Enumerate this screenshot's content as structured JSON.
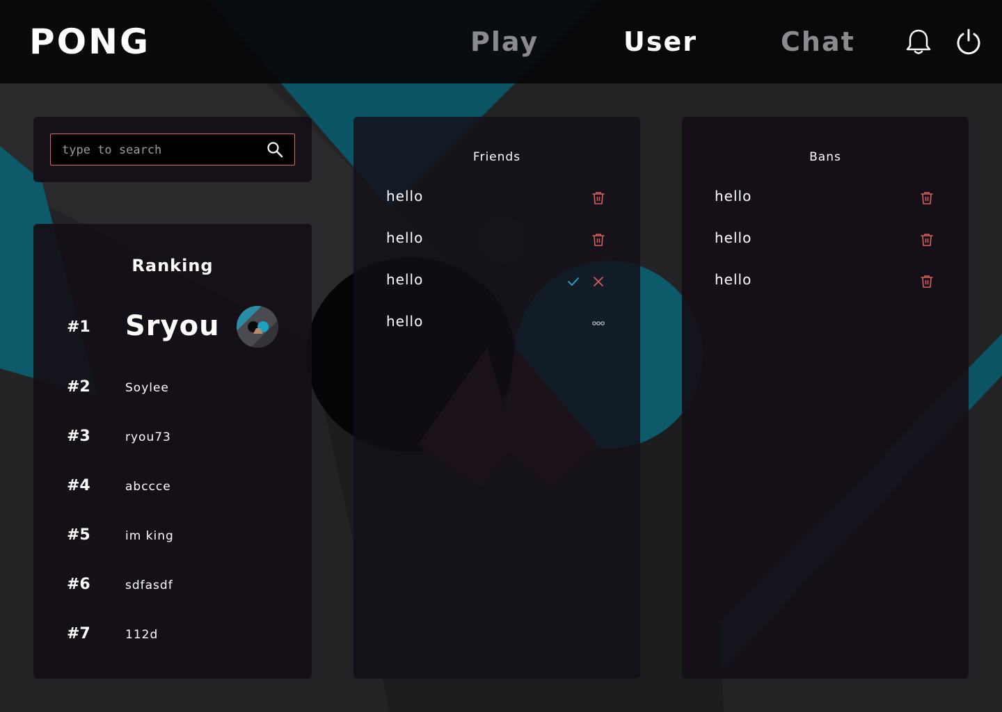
{
  "header": {
    "logo": "PONG",
    "nav": {
      "play": "Play",
      "user": "User",
      "chat": "Chat"
    },
    "active_tab": "User",
    "icons": {
      "notifications": "bell-icon",
      "logout": "power-icon"
    }
  },
  "search": {
    "placeholder": "type to search",
    "value": "",
    "icon": "search-icon"
  },
  "ranking": {
    "title": "Ranking",
    "entries": [
      {
        "rank": "#1",
        "name": "Sryou"
      },
      {
        "rank": "#2",
        "name": "Soylee"
      },
      {
        "rank": "#3",
        "name": "ryou73"
      },
      {
        "rank": "#4",
        "name": "abccce"
      },
      {
        "rank": "#5",
        "name": "im king"
      },
      {
        "rank": "#6",
        "name": "sdfasdf"
      },
      {
        "rank": "#7",
        "name": "112d"
      }
    ]
  },
  "friends": {
    "title": "Friends",
    "items": [
      {
        "name": "hello",
        "action": "trash-icon"
      },
      {
        "name": "hello",
        "action": "trash-icon"
      },
      {
        "name": "hello",
        "action": "accept-reject"
      },
      {
        "name": "hello",
        "action": "more-icon"
      }
    ]
  },
  "bans": {
    "title": "Bans",
    "items": [
      {
        "name": "hello",
        "action": "trash-icon"
      },
      {
        "name": "hello",
        "action": "trash-icon"
      },
      {
        "name": "hello",
        "action": "trash-icon"
      }
    ]
  },
  "colors": {
    "accent_teal": "#0c6677",
    "background": "#232325",
    "panel": "#140f17",
    "header": "#08080a",
    "danger": "#d9605f",
    "accept": "#29a9c8",
    "nav_inactive": "#8a8a8f"
  }
}
